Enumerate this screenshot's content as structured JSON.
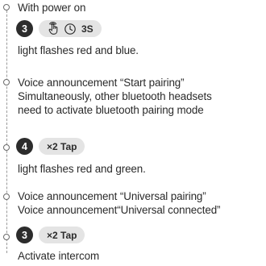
{
  "blocks": [
    {
      "text_lines": [
        "With power on"
      ]
    },
    {
      "step": {
        "number": "3",
        "icons": [
          "tap-hold-icon",
          "clock-icon"
        ],
        "label": "3S"
      }
    },
    {
      "text_lines": [
        "light flashes red and blue."
      ]
    },
    {
      "text_lines": [
        "Voice announcement “Start pairing”",
        "Simultaneously, other bluetooth headsets",
        "need to activate bluetooth pairing mode"
      ]
    },
    {
      "step": {
        "number": "4",
        "label": "×2 Tap"
      }
    },
    {
      "text_lines": [
        "light flashes red and green."
      ]
    },
    {
      "text_lines": [
        "Voice announcement “Universal pairing”",
        "Voice announcement“Universal connected”"
      ]
    },
    {
      "step": {
        "number": "3",
        "label": "×2 Tap"
      }
    },
    {
      "text_lines": [
        "Activate intercom"
      ]
    }
  ],
  "colors": {
    "step_circle": "#2c2c2c",
    "pill_background": "#e4e4e4",
    "text": "#2a2a2a",
    "timeline": "#9a9a9a"
  }
}
